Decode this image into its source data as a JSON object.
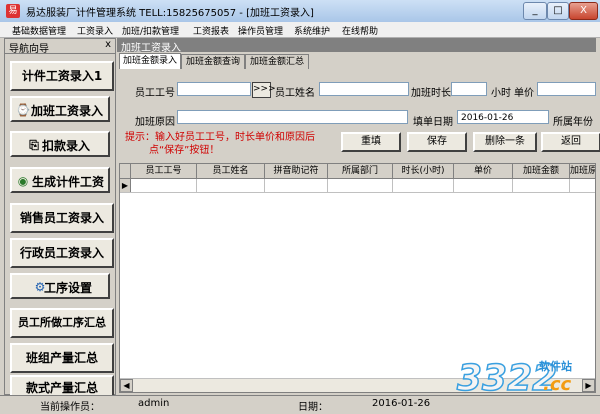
{
  "window": {
    "title": "易达服装厂计件管理系统  TELL:15825675057 - [加班工资录入]",
    "minimize": "_",
    "restore": "□",
    "close": "X"
  },
  "menu": [
    "基础数据管理",
    "工资录入",
    "加班/扣款管理",
    "工资报表",
    "操作员管理",
    "系统维护",
    "在线帮助"
  ],
  "nav": {
    "header": "导航向导",
    "close": "x",
    "items": [
      {
        "label": "计件工资录入1",
        "icon": ""
      },
      {
        "label": "加班工资录入",
        "icon": "time-icon"
      },
      {
        "label": "扣款录入",
        "icon": "deduct-icon"
      },
      {
        "label": "生成计件工资",
        "icon": "money-bag-icon"
      },
      {
        "label": "销售员工资录入",
        "icon": ""
      },
      {
        "label": "行政员工资录入",
        "icon": ""
      },
      {
        "label": "工序设置",
        "icon": "settings-icon"
      },
      {
        "label": "员工所做工序汇总",
        "icon": ""
      },
      {
        "label": "班组产量汇总",
        "icon": ""
      },
      {
        "label": "款式产量汇总",
        "icon": ""
      }
    ]
  },
  "pane": {
    "header": "加班工资录入",
    "tabs": [
      "加班金额录入",
      "加班金额查询",
      "加班金额汇总"
    ],
    "form": {
      "emp_no_label": "员工工号",
      "emp_no_value": "",
      "lookup_button": ">>>",
      "emp_name_label": "员工姓名",
      "emp_name_value": "",
      "ot_hours_label": "加班时长",
      "ot_hours_value": "",
      "hours_unit": "小时",
      "unit_price_label": "单价",
      "unit_price_value": "",
      "reason_label": "加班原因",
      "reason_value": "",
      "fill_date_label": "填单日期",
      "fill_date_value": "2016-01-26",
      "year_label": "所属年份"
    },
    "hint_line1": "提示：输入好员工工号，时长单价和原因后",
    "hint_line2": "点“保存”按钮！",
    "buttons": {
      "refill": "重填",
      "save": "保存",
      "delete_one": "删除一条",
      "back": "返回"
    },
    "grid": {
      "columns": [
        "员工工号",
        "员工姓名",
        "拼音助记符",
        "所属部门",
        "时长(小时)",
        "单价",
        "加班金额",
        "加班原因"
      ],
      "row_indicator": "▶"
    }
  },
  "status": {
    "operator_label": "当前操作员：",
    "operator_value": "admin",
    "date_label": "日期：",
    "date_value": "2016-01-26"
  },
  "watermark": {
    "number": "3322",
    "site": "软件站",
    "domain": ".cc"
  }
}
